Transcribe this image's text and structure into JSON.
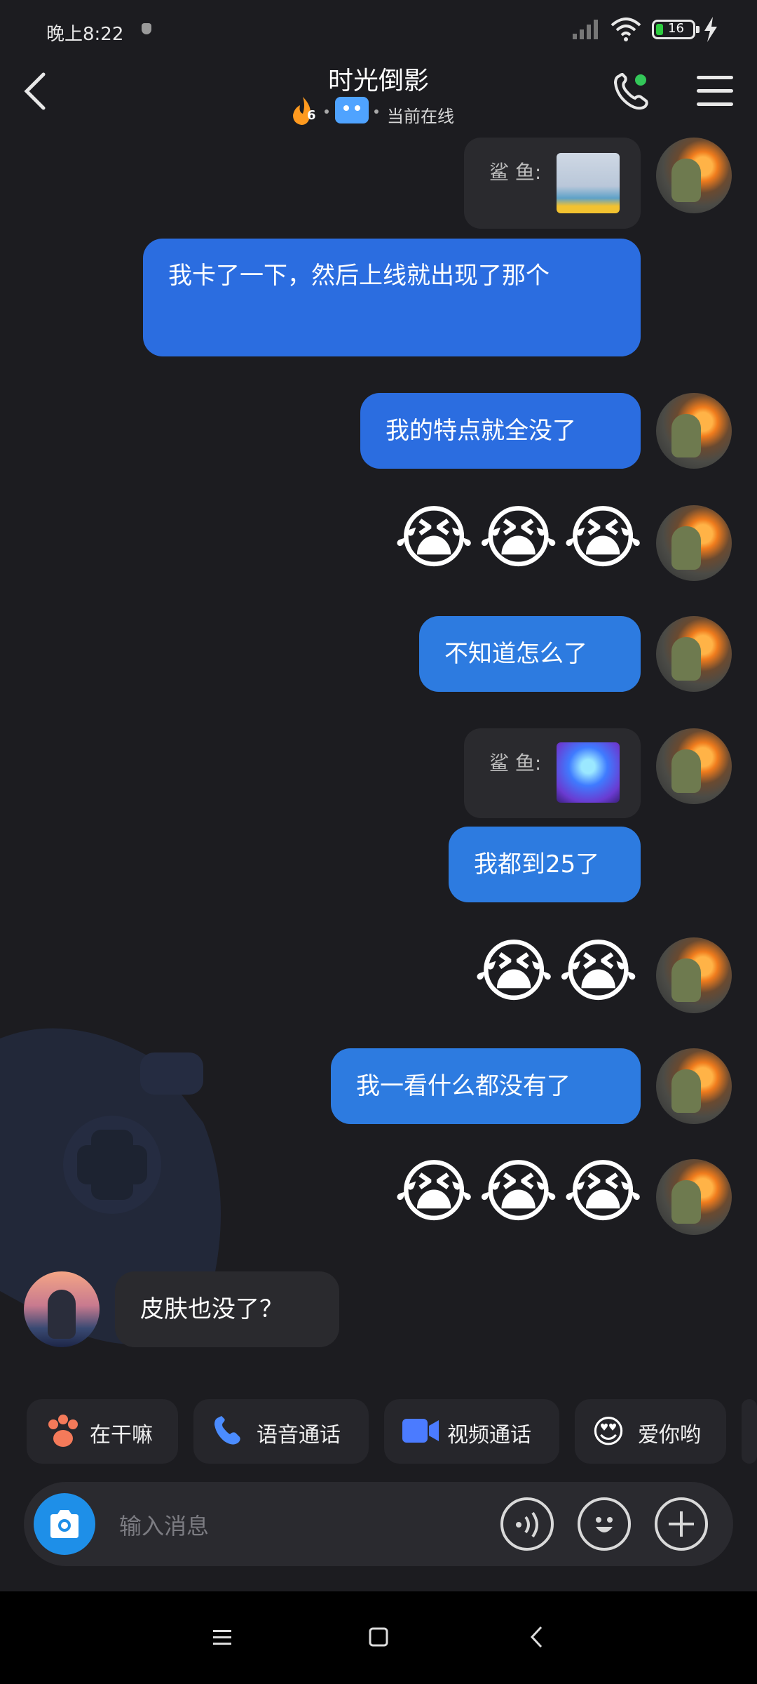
{
  "status_bar": {
    "time": "晚上8:22",
    "battery": "16"
  },
  "header": {
    "title": "时光倒影",
    "fire_count": "6",
    "status": "当前在线"
  },
  "messages": [
    {
      "type": "share",
      "label": "鲨  鱼:"
    },
    {
      "type": "text",
      "text": "我卡了一下，然后上线就出现了那个"
    },
    {
      "type": "text",
      "text": "我的特点就全没了"
    },
    {
      "type": "emoji",
      "text": "😭😭😭"
    },
    {
      "type": "text",
      "text": "不知道怎么了"
    },
    {
      "type": "share",
      "label": "鲨  鱼:"
    },
    {
      "type": "text",
      "text": "我都到25了"
    },
    {
      "type": "emoji",
      "text": "😭😭"
    },
    {
      "type": "text",
      "text": "我一看什么都没有了"
    },
    {
      "type": "emoji",
      "text": "😭😭😭"
    },
    {
      "type": "text",
      "text": "皮肤也没了？"
    }
  ],
  "quick_actions": [
    {
      "label": "在干嘛",
      "icon": "paw-icon"
    },
    {
      "label": "语音通话",
      "icon": "phone-icon"
    },
    {
      "label": "视频通话",
      "icon": "video-icon"
    },
    {
      "label": "爱你哟",
      "icon": "heart-eyes-icon"
    }
  ],
  "input": {
    "placeholder": "输入消息"
  },
  "colors": {
    "accent": "#2b6de0",
    "camera": "#1e8fe8",
    "online": "#33c759"
  }
}
